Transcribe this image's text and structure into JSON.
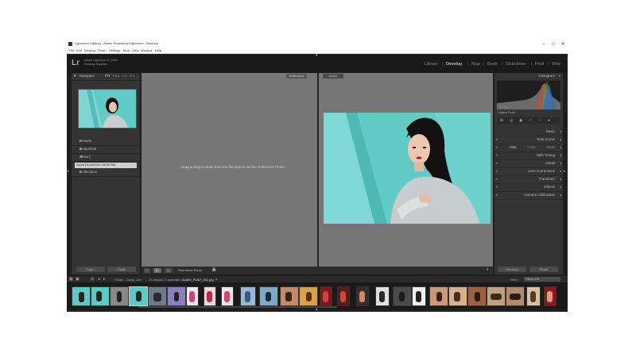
{
  "window": {
    "title": "Lightroom Catalog - Adobe Photoshop Lightroom - Develop",
    "controls": {
      "minimize": "–",
      "maximize": "□",
      "close": "✕"
    },
    "menu": [
      "File",
      "Edit",
      "Develop",
      "Photo",
      "Settings",
      "Tools",
      "View",
      "Window",
      "Help"
    ]
  },
  "identity_plate": {
    "logo": "Lr",
    "version_line1": "Adobe Lightroom CC 2015",
    "version_line2": "Shotdrop Supplies"
  },
  "modules": [
    "Library",
    "Develop",
    "Map",
    "Book",
    "Slideshow",
    "Print",
    "Web"
  ],
  "active_module": "Develop",
  "left_panel": {
    "navigator": {
      "title": "Navigator",
      "zoom_options": [
        "FIT",
        "FILL",
        "1:1",
        "3:1"
      ]
    },
    "presets": "Presets",
    "snapshots": "Snapshots",
    "history": {
      "title": "History",
      "entry": "Import (11/18/2016 1:46:28 PM)"
    },
    "collections": "Collections",
    "copy_label": "Copy...",
    "paste_label": "Paste"
  },
  "center": {
    "reference_tab": "Reference",
    "active_tab": "Active",
    "drop_hint": "Drag & drop a photo from the filmstrip to set the Reference Photo",
    "toolbar_label": "Reference Photo :"
  },
  "right_panel": {
    "histogram_title": "Histogram",
    "histogram_info": "Original Photo",
    "sections": [
      "Basic",
      "Tone Curve",
      "HSL / Color / B&W",
      "Split Toning",
      "Detail",
      "Lens Corrections",
      "Transform",
      "Effects",
      "Camera Calibration"
    ],
    "hsl_parts": [
      "HSL",
      "Color",
      "B&W"
    ],
    "previous_label": "Previous",
    "reset_label": "Reset"
  },
  "filmstrip": {
    "source": "Folder : Jorda_Lee",
    "count": "47 photos / 1 selected /",
    "filename": "Adobe_PLM7_001.jpg",
    "filter_label": "Filter :",
    "filter_value": "Filters Off"
  },
  "colors": {
    "teal_background": "#63cbc6",
    "panel": "#343434",
    "frame": "#1f1f1f"
  }
}
